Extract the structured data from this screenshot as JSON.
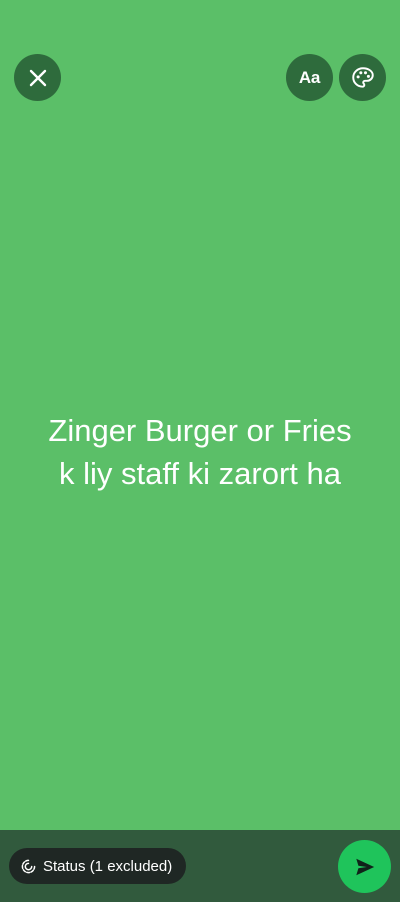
{
  "status_text": "Zinger Burger or Fries\nk liy staff ki zarort ha",
  "toolbar": {
    "close_icon": "close-icon",
    "text_style_label": "Aa",
    "palette_icon": "palette-icon"
  },
  "bottom_bar": {
    "audience_label": "Status (1 excluded)",
    "audience_icon": "status-ring-icon",
    "send_icon": "send-icon"
  },
  "colors": {
    "background": "#5bbf68",
    "button_bg": "#2e6b3c",
    "bottom_bar": "#315a3d",
    "pill_bg": "#1f2724",
    "send_button": "#1fc45b",
    "text": "#ffffff"
  }
}
